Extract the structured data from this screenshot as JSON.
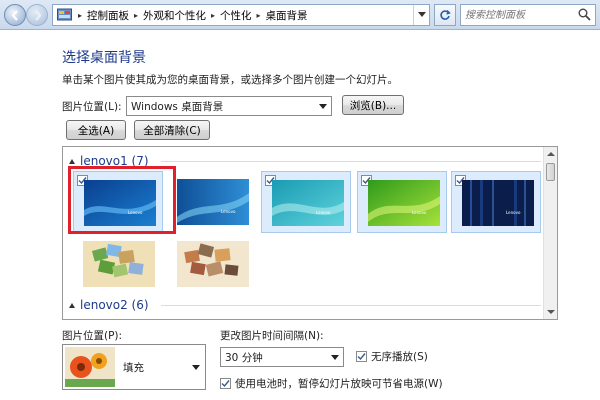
{
  "address_bar": {
    "crumbs": [
      "控制面板",
      "外观和个性化",
      "个性化",
      "桌面背景"
    ],
    "search_placeholder": "搜索控制面板"
  },
  "page": {
    "title": "选择桌面背景",
    "subtitle": "单击某个图片使其成为您的桌面背景，或选择多个图片创建一个幻灯片。"
  },
  "picture_location": {
    "label": "图片位置(L):",
    "value": "Windows 桌面背景",
    "browse_button": "浏览(B)..."
  },
  "buttons": {
    "select_all": "全选(A)",
    "clear_all": "全部清除(C)"
  },
  "gallery": {
    "groups": [
      {
        "name": "lenovo1 (7)",
        "items": [
          {
            "style": "blue-dark",
            "checked": true,
            "selected": true,
            "brand": "Lenovo"
          },
          {
            "style": "blue-swirl",
            "checked": false,
            "selected": false,
            "brand": "Lenovo"
          },
          {
            "style": "cyan",
            "checked": true,
            "selected": true,
            "brand": "Lenovo"
          },
          {
            "style": "green",
            "checked": true,
            "selected": true,
            "brand": "Lenovo"
          },
          {
            "style": "navy",
            "checked": true,
            "selected": true,
            "brand": "Lenovo"
          },
          {
            "style": "collage-a",
            "checked": false,
            "selected": false,
            "brand": ""
          },
          {
            "style": "collage-b",
            "checked": false,
            "selected": false,
            "brand": ""
          }
        ]
      },
      {
        "name": "lenovo2 (6)",
        "items": []
      }
    ]
  },
  "bottom": {
    "position_label": "图片位置(P):",
    "position_value": "填充",
    "interval_label": "更改图片时间间隔(N):",
    "interval_value": "30 分钟",
    "shuffle_label": "无序播放(S)",
    "shuffle_checked": true,
    "battery_label": "使用电池时，暂停幻灯片放映可节省电源(W)",
    "battery_checked": true
  },
  "colors": {
    "title_blue": "#1e3b8a",
    "selection_bg": "#dcecfc",
    "highlight_red": "#e0202a"
  }
}
